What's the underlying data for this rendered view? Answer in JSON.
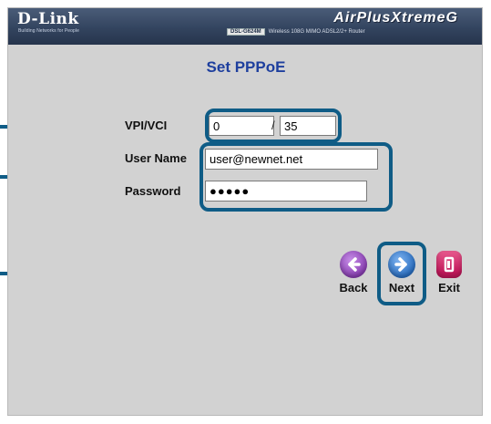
{
  "header": {
    "logo": "D-Link",
    "tagline": "Building Networks for People",
    "brand": "AirPlusXtremeG",
    "model_badge": "DSL-G624M",
    "model_desc": "Wireless 108G MIMO ADSL2/2+ Router"
  },
  "page": {
    "title": "Set PPPoE"
  },
  "form": {
    "vpi_vci_label": "VPI/VCI",
    "vpi_value": "0",
    "separator": "/",
    "vci_value": "35",
    "username_label": "User Name",
    "username_value": "user@newnet.net",
    "password_label": "Password",
    "password_value": "●●●●●"
  },
  "nav": {
    "back_label": "Back",
    "next_label": "Next",
    "exit_label": "Exit"
  },
  "colors": {
    "title": "#1e3f9e",
    "callout": "#0f5c86",
    "back": "#8a3fb3",
    "next": "#2a6fc2",
    "exit": "#c2185b"
  }
}
